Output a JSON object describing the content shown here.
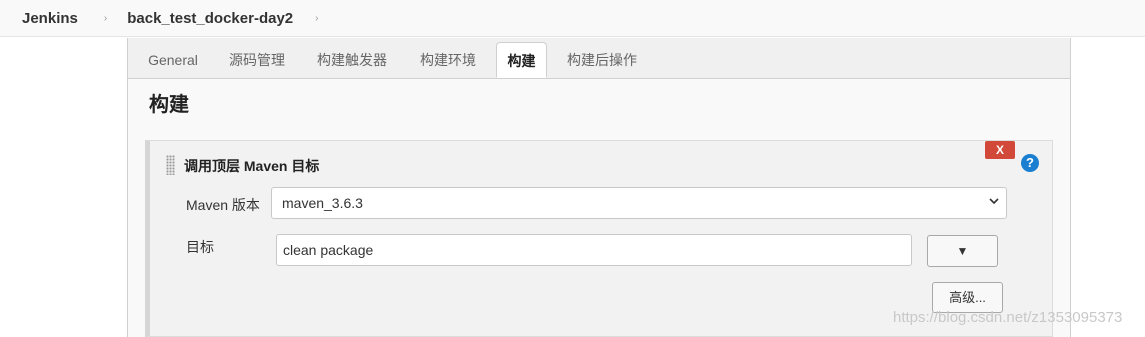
{
  "breadcrumb": {
    "root": "Jenkins",
    "job": "back_test_docker-day2",
    "separator": "›"
  },
  "tabs": [
    {
      "label": "General",
      "active": false
    },
    {
      "label": "源码管理",
      "active": false
    },
    {
      "label": "构建触发器",
      "active": false
    },
    {
      "label": "构建环境",
      "active": false
    },
    {
      "label": "构建",
      "active": true
    },
    {
      "label": "构建后操作",
      "active": false
    }
  ],
  "section": {
    "title": "构建"
  },
  "build_step": {
    "title": "调用顶层 Maven 目标",
    "delete_label": "X",
    "help_label": "?",
    "maven_version_label": "Maven 版本",
    "maven_version_value": "maven_3.6.3",
    "goals_label": "目标",
    "goals_value": "clean package",
    "expand_label": "▼",
    "advanced_label": "高级..."
  },
  "watermark": "https://blog.csdn.net/z1353095373",
  "colors": {
    "delete_button": "#d24939",
    "help_icon": "#1b7fd1"
  }
}
